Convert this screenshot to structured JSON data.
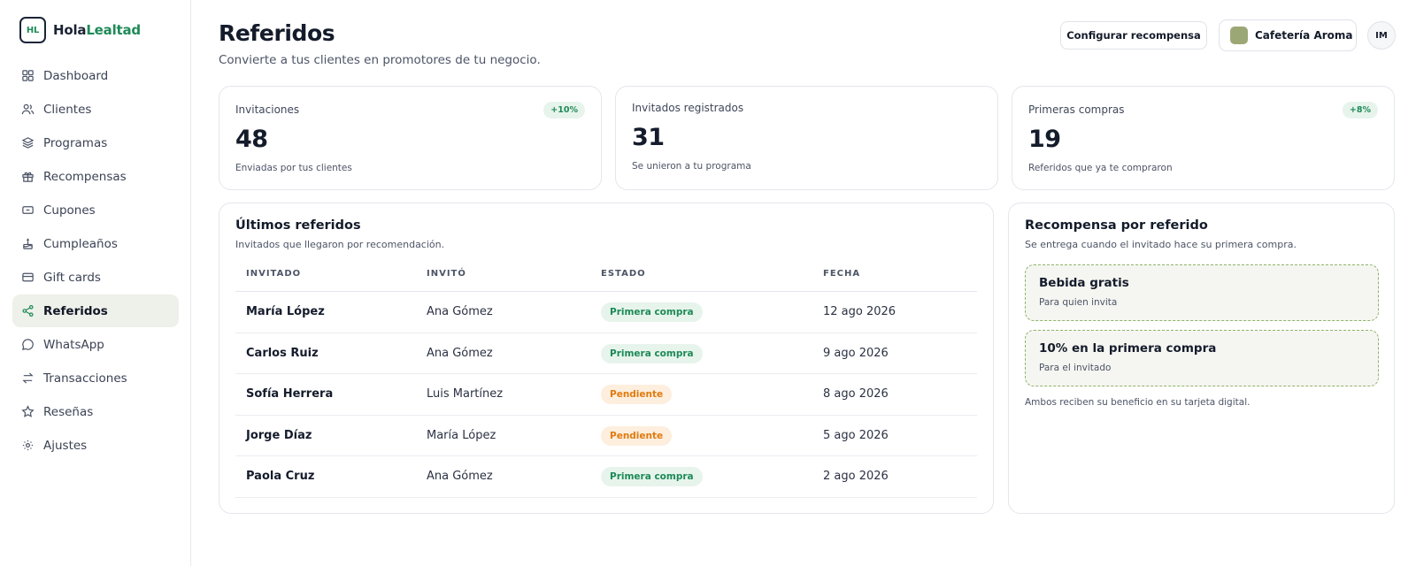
{
  "brand": {
    "mark": "HL",
    "name_part1": "Hola",
    "name_part2": "Lealtad"
  },
  "sidebar": {
    "items": [
      {
        "label": "Dashboard",
        "icon": "grid-icon"
      },
      {
        "label": "Clientes",
        "icon": "users-icon"
      },
      {
        "label": "Programas",
        "icon": "layers-icon"
      },
      {
        "label": "Recompensas",
        "icon": "gift-icon"
      },
      {
        "label": "Cupones",
        "icon": "ticket-icon"
      },
      {
        "label": "Cumpleaños",
        "icon": "cake-icon"
      },
      {
        "label": "Gift cards",
        "icon": "card-icon"
      },
      {
        "label": "Referidos",
        "icon": "share-icon",
        "active": true
      },
      {
        "label": "WhatsApp",
        "icon": "chat-icon"
      },
      {
        "label": "Transacciones",
        "icon": "swap-icon"
      },
      {
        "label": "Reseñas",
        "icon": "star-icon"
      },
      {
        "label": "Ajustes",
        "icon": "settings-icon"
      }
    ]
  },
  "header": {
    "title": "Referidos",
    "subtitle": "Convierte a tus clientes en promotores de tu negocio.",
    "config_button": "Configurar recompensa",
    "business_name": "Cafetería Aroma",
    "business_color": "#9ca776",
    "avatar_initials": "IM"
  },
  "stats": [
    {
      "label": "Invitaciones",
      "value": "48",
      "note": "Enviadas por tus clientes",
      "badge": "+10%"
    },
    {
      "label": "Invitados registrados",
      "value": "31",
      "note": "Se unieron a tu programa"
    },
    {
      "label": "Primeras compras",
      "value": "19",
      "note": "Referidos que ya te compraron",
      "badge": "+8%"
    }
  ],
  "referrals": {
    "title": "Últimos referidos",
    "subtitle": "Invitados que llegaron por recomendación.",
    "columns": [
      "INVITADO",
      "INVITÓ",
      "ESTADO",
      "FECHA"
    ],
    "rows": [
      {
        "invitee": "María López",
        "inviter": "Ana Gómez",
        "status": "Primera compra",
        "date": "12 ago 2026"
      },
      {
        "invitee": "Carlos Ruiz",
        "inviter": "Ana Gómez",
        "status": "Primera compra",
        "date": "9 ago 2026"
      },
      {
        "invitee": "Sofía Herrera",
        "inviter": "Luis Martínez",
        "status": "Pendiente",
        "date": "8 ago 2026"
      },
      {
        "invitee": "Jorge Díaz",
        "inviter": "María López",
        "status": "Pendiente",
        "date": "5 ago 2026"
      },
      {
        "invitee": "Paola Cruz",
        "inviter": "Ana Gómez",
        "status": "Primera compra",
        "date": "2 ago 2026"
      }
    ]
  },
  "reward": {
    "title": "Recompensa por referido",
    "subtitle": "Se entrega cuando el invitado hace su primera compra.",
    "options": [
      {
        "title": "Bebida gratis",
        "subtitle": "Para quien invita"
      },
      {
        "title": "10% en la primera compra",
        "subtitle": "Para el invitado"
      }
    ],
    "note": "Ambos reciben su beneficio en su tarjeta digital."
  },
  "colors": {
    "accent": "#1e8a57",
    "pending": "#e07b0f",
    "active_bg": "#eef0ea"
  }
}
